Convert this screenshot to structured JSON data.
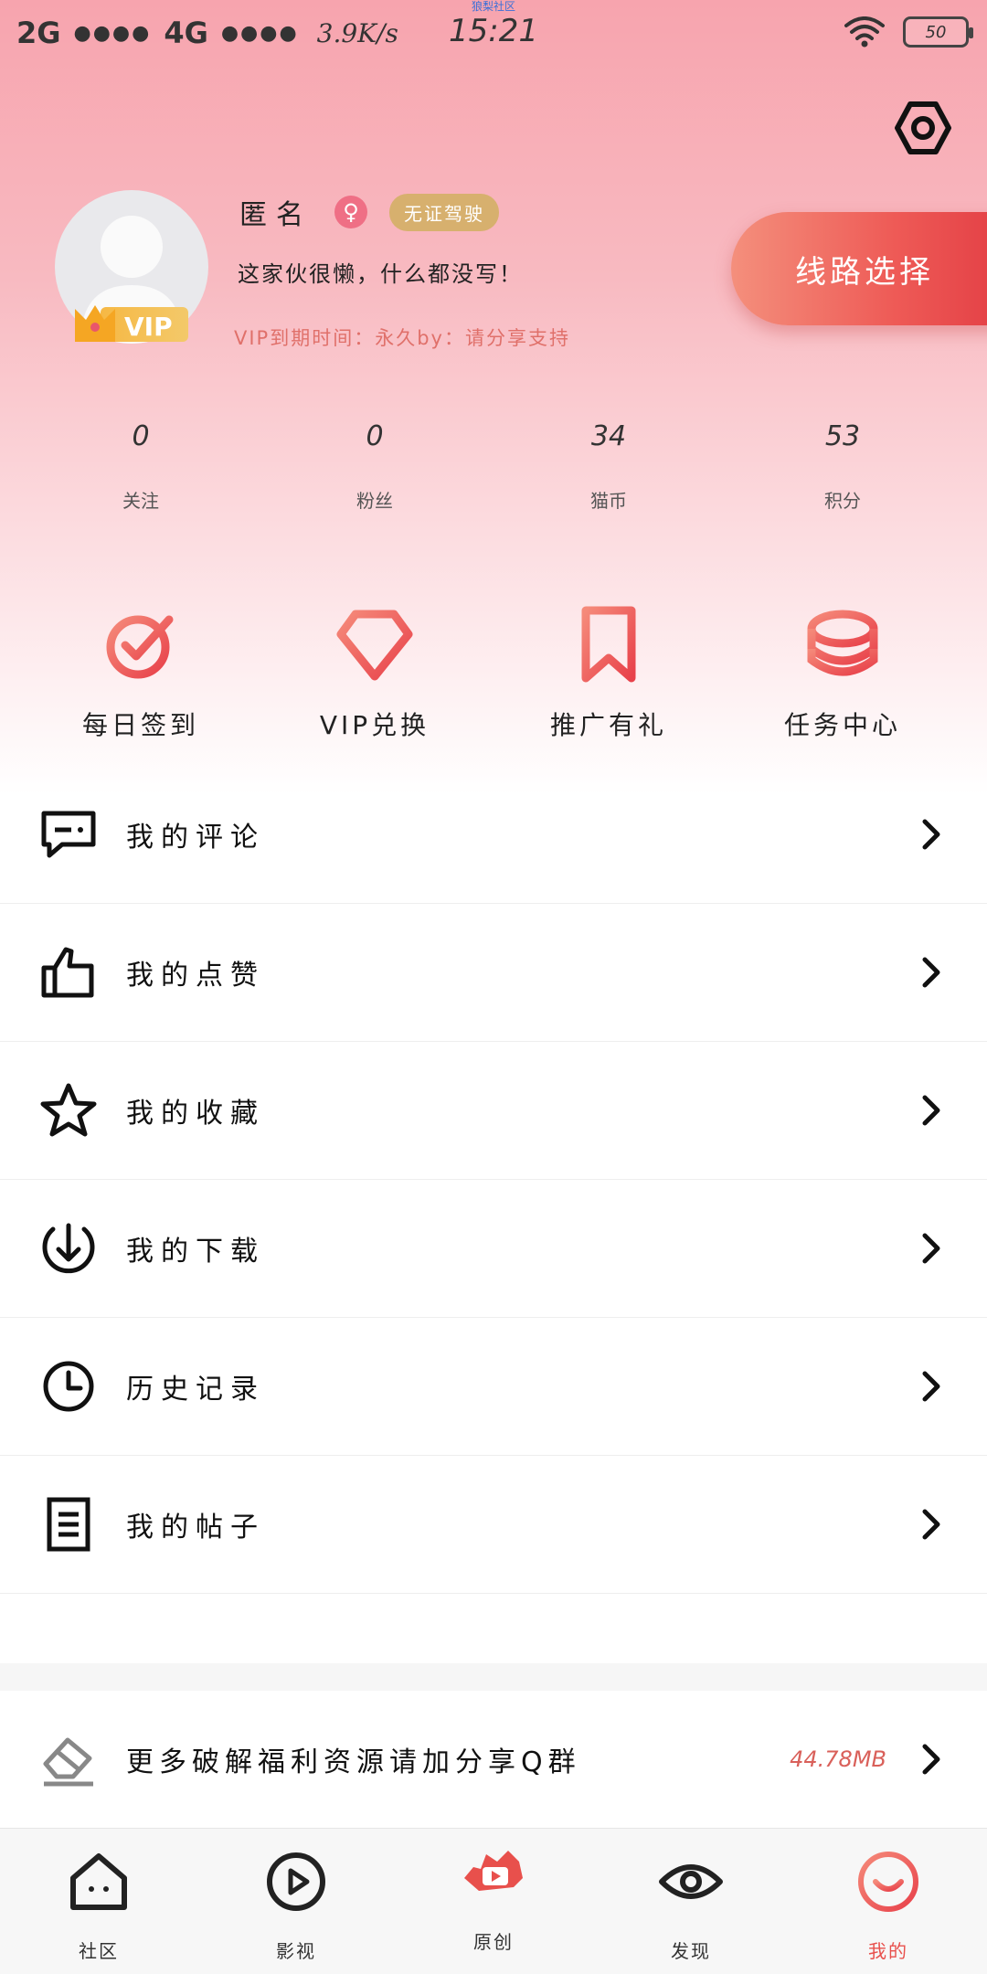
{
  "status_bar": {
    "network1": "2G",
    "network2": "4G",
    "signal_dots": "●●●●",
    "speed": "3.9K/s",
    "app_name": "狼梨社区",
    "time": "15:21",
    "battery": "50"
  },
  "profile": {
    "name": "匿名",
    "gender_symbol": "♀",
    "tag": "无证驾驶",
    "bio": "这家伙很懒，什么都没写！",
    "vip_expire": "VIP到期时间：永久by：请分享支持",
    "vip_label": "VIP",
    "route_button": "线路选择"
  },
  "stats": [
    {
      "value": "0",
      "label": "关注"
    },
    {
      "value": "0",
      "label": "粉丝"
    },
    {
      "value": "34",
      "label": "猫币"
    },
    {
      "value": "53",
      "label": "积分"
    }
  ],
  "actions": [
    {
      "label": "每日签到",
      "icon": "checkin-icon"
    },
    {
      "label": "VIP兑换",
      "icon": "diamond-icon"
    },
    {
      "label": "推广有礼",
      "icon": "bookmark-icon"
    },
    {
      "label": "任务中心",
      "icon": "coins-icon"
    }
  ],
  "menu": [
    {
      "label": "我的评论",
      "icon": "comment-icon"
    },
    {
      "label": "我的点赞",
      "icon": "thumb-up-icon"
    },
    {
      "label": "我的收藏",
      "icon": "star-icon"
    },
    {
      "label": "我的下载",
      "icon": "download-icon"
    },
    {
      "label": "历史记录",
      "icon": "clock-icon"
    },
    {
      "label": "我的帖子",
      "icon": "document-icon"
    }
  ],
  "promo": {
    "label": "更多破解福利资源请加分享Q群",
    "size": "44.78MB",
    "icon": "eraser-icon"
  },
  "tabs": [
    {
      "label": "社区",
      "icon": "home-icon"
    },
    {
      "label": "影视",
      "icon": "play-icon"
    },
    {
      "label": "原创",
      "icon": "original-icon"
    },
    {
      "label": "发现",
      "icon": "eye-icon"
    },
    {
      "label": "我的",
      "icon": "smile-icon",
      "active": true
    }
  ],
  "colors": {
    "accent": "#e8504c",
    "hero_top": "#f7a4ae",
    "tag_gold": "#d7b06e",
    "vip_text": "#e0706a"
  }
}
